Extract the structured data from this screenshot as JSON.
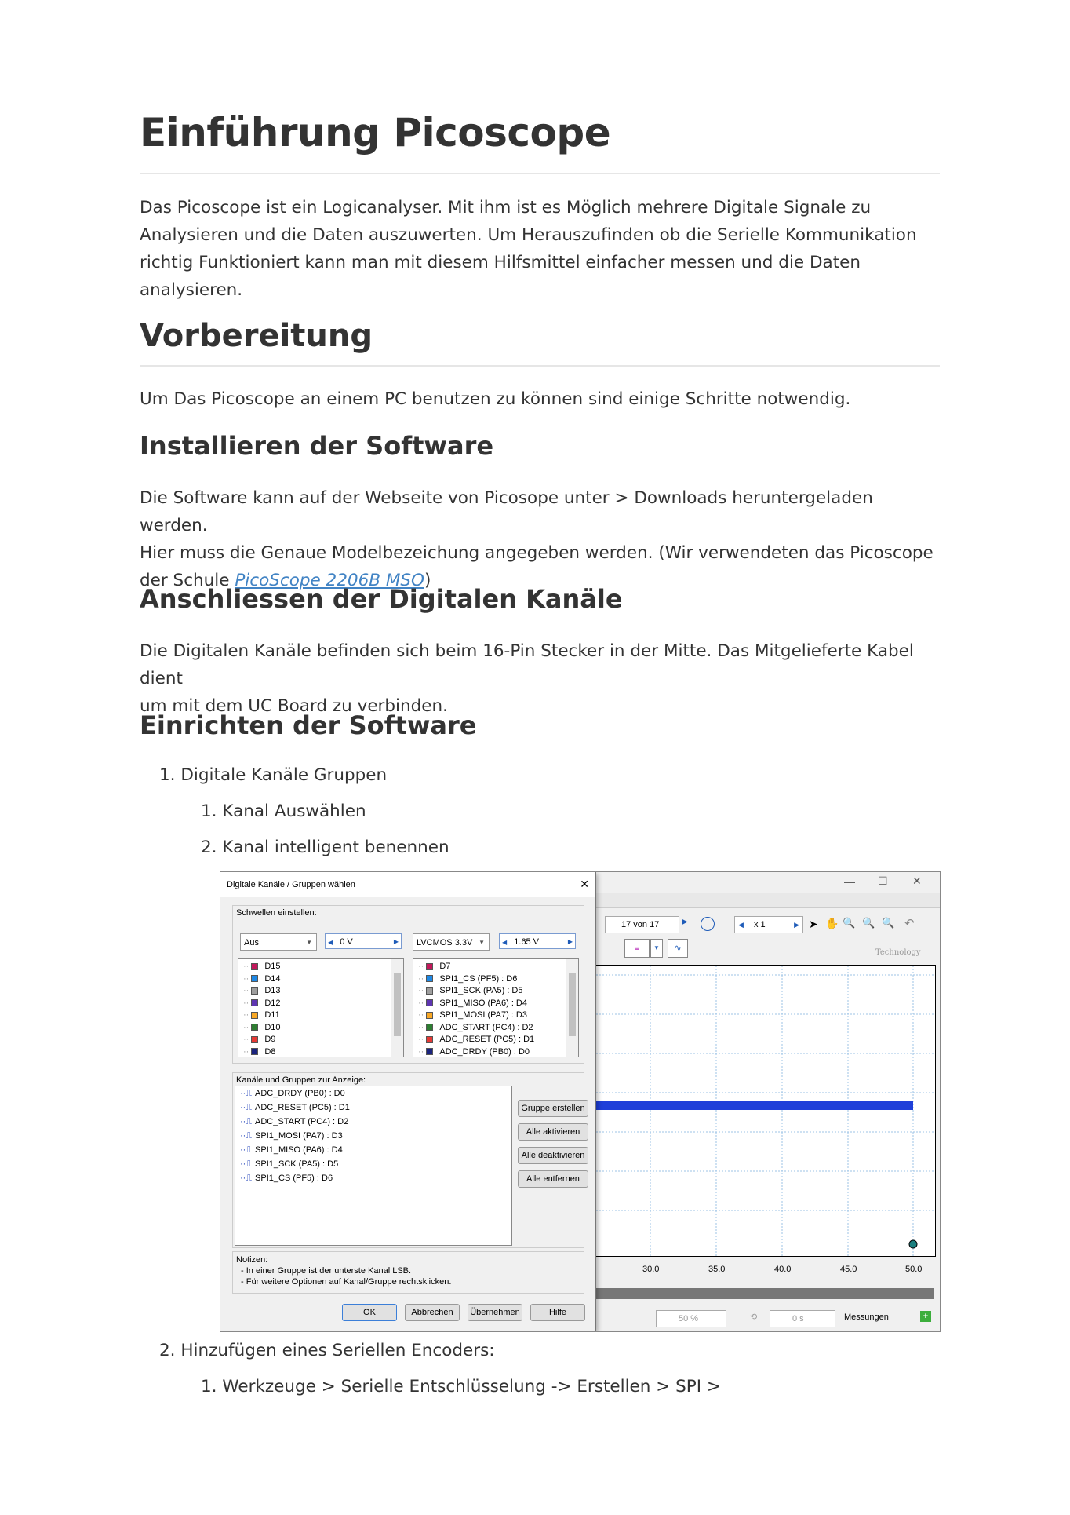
{
  "title": "Einführung Picoscope",
  "intro": [
    "Das Picoscope ist ein Logicanalyser. Mit ihm ist es Möglich mehrere Digitale Signale zu",
    "Analysieren und die Daten auszuwerten. Um Herauszufinden ob die Serielle Kommunikation",
    "richtig Funktioniert kann man mit diesem Hilfsmittel einfacher messen und die Daten",
    "analysieren."
  ],
  "section1": {
    "heading": "Vorbereitung",
    "text": "Um Das Picoscope an einem PC benutzen zu können sind einige Schritte notwendig."
  },
  "sub1": {
    "heading": "Installieren der Software",
    "line1": "Die Software kann auf der Webseite von Picosope unter > Downloads heruntergeladen werden.",
    "line2": "Hier muss die Genaue Modelbezeichung angegeben werden. (Wir verwendeten das Picoscope",
    "line3_pre": "der Schule ",
    "link": "PicoScope 2206B MSO",
    "line3_post": ")"
  },
  "sub2": {
    "heading": "Anschliessen der Digitalen Kanäle",
    "line1": "Die Digitalen Kanäle befinden sich beim 16-Pin Stecker in der Mitte. Das Mitgelieferte Kabel dient",
    "line2": "um mit dem UC Board zu verbinden."
  },
  "sub3": {
    "heading": "Einrichten der Software",
    "items": [
      {
        "num": "1.",
        "text": "Digitale Kanäle Gruppen"
      },
      {
        "num": "1.",
        "text": "Kanal Auswählen"
      },
      {
        "num": "2.",
        "text": "Kanal intelligent benennen"
      },
      {
        "num": "2.",
        "text": "Hinzufügen eines Seriellen Encoders:"
      },
      {
        "num": "1.",
        "text": "Werkzeuge > Serielle Entschlüsselung -> Erstellen > SPI >"
      }
    ]
  },
  "screenshot": {
    "dialog_title": "Digitale Kanäle / Gruppen wählen",
    "close_glyph": "✕",
    "thresholds_label": "Schwellen einstellen:",
    "combo_left": "Aus",
    "spin_left": "0 V",
    "combo_right": "LVCMOS 3.3V",
    "spin_right": "1.65 V",
    "left_channels": [
      {
        "label": "D15",
        "color": "#c2185b"
      },
      {
        "label": "D14",
        "color": "#1e88e5"
      },
      {
        "label": "D13",
        "color": "#9e9e9e"
      },
      {
        "label": "D12",
        "color": "#5e35b1"
      },
      {
        "label": "D11",
        "color": "#f9a825"
      },
      {
        "label": "D10",
        "color": "#2e7d32"
      },
      {
        "label": "D9",
        "color": "#e53935"
      },
      {
        "label": "D8",
        "color": "#1a237e"
      }
    ],
    "right_channels": [
      {
        "label": "D7",
        "color": "#c2185b"
      },
      {
        "label": "SPI1_CS (PF5) : D6",
        "color": "#1e88e5"
      },
      {
        "label": "SPI1_SCK (PA5) : D5",
        "color": "#9e9e9e"
      },
      {
        "label": "SPI1_MISO (PA6) : D4",
        "color": "#5e35b1"
      },
      {
        "label": "SPI1_MOSI (PA7) : D3",
        "color": "#f9a825"
      },
      {
        "label": "ADC_START (PC4) : D2",
        "color": "#2e7d32"
      },
      {
        "label": "ADC_RESET (PC5) : D1",
        "color": "#e53935"
      },
      {
        "label": "ADC_DRDY (PB0) : D0",
        "color": "#1a237e"
      }
    ],
    "groups_label": "Kanäle und Gruppen zur Anzeige:",
    "group_items": [
      "ADC_DRDY (PB0) : D0",
      "ADC_RESET (PC5) : D1",
      "ADC_START (PC4) : D2",
      "SPI1_MOSI (PA7) : D3",
      "SPI1_MISO (PA6) : D4",
      "SPI1_SCK (PA5) : D5",
      "SPI1_CS (PF5) : D6"
    ],
    "group_glyph": "⎍",
    "buttons_side": [
      "Gruppe erstellen",
      "Alle aktivieren",
      "Alle deaktivieren",
      "Alle entfernen"
    ],
    "notes_label": "Notizen:",
    "notes": [
      "- In einer Gruppe ist der unterste Kanal LSB.",
      "- Für weitere Optionen auf Kanal/Gruppe rechtsklicken."
    ],
    "buttons_bottom": [
      "OK",
      "Abbrechen",
      "Übernehmen",
      "Hilfe"
    ],
    "main_win": {
      "min_glyph": "—",
      "max_glyph": "☐",
      "close_glyph": "✕",
      "capture_count": "17 von 17",
      "zoom": "x 1",
      "logo_text": "Technology",
      "xticks": [
        "30.0",
        "35.0",
        "40.0",
        "45.0",
        "50.0"
      ],
      "status_percent": "50 %",
      "status_time": "0 s",
      "measurements": "Messungen",
      "plus_glyph": "+"
    }
  }
}
